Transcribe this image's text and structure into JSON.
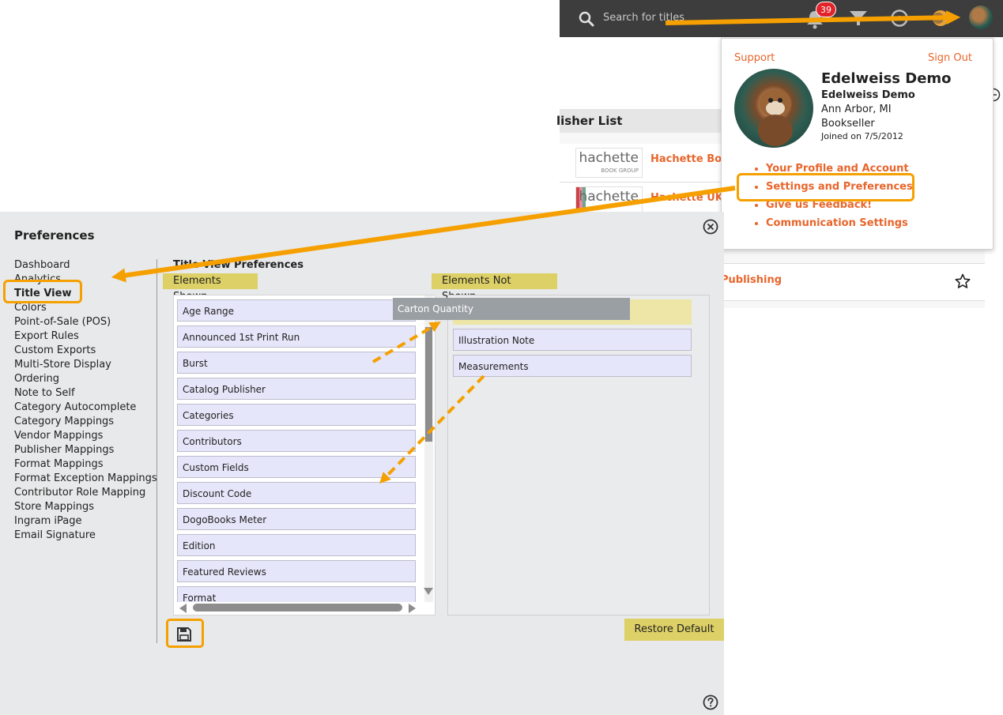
{
  "topbar": {
    "search_placeholder": "Search for titles",
    "notification_count": "39",
    "icons": [
      "search-icon",
      "bell-icon",
      "filter-icon",
      "circle-icon",
      "orange-circle-icon",
      "avatar"
    ]
  },
  "background_page": {
    "header": "lisher List",
    "rows": [
      {
        "logo_text": "hachette",
        "logo_sub": "BOOK GROUP",
        "link": "Hachette Book"
      },
      {
        "logo_text": "hachette",
        "logo_sub": "",
        "link": "Hachette UK G"
      }
    ],
    "publishing_link": "Publishing"
  },
  "profile": {
    "support_label": "Support",
    "signout_label": "Sign Out",
    "name": "Edelweiss Demo",
    "organization": "Edelweiss Demo",
    "location": "Ann Arbor, MI",
    "role": "Bookseller",
    "joined": "Joined on 7/5/2012",
    "menu": [
      "Your Profile and Account",
      "Settings and Preferences",
      "Give us Feedback!",
      "Communication Settings"
    ]
  },
  "preferences": {
    "title": "Preferences",
    "nav": [
      "Dashboard",
      "Analytics",
      "Title View",
      "Colors",
      "Point-of-Sale (POS)",
      "Export Rules",
      "Custom Exports",
      "Multi-Store Display",
      "Ordering",
      "Note to Self",
      "Category Autocomplete",
      "Category Mappings",
      "Vendor Mappings",
      "Publisher Mappings",
      "Format Mappings",
      "Format Exception Mappings",
      "Contributor Role Mapping",
      "Store Mappings",
      "Ingram iPage",
      "Email Signature"
    ],
    "active_nav": "Title View",
    "section_title": "Title View Preferences",
    "elements_shown_label": "Elements Shown",
    "elements_not_shown_label": "Elements Not Shown",
    "elements_shown": [
      "Age Range",
      "Announced 1st Print Run",
      "Burst",
      "Catalog Publisher",
      "Categories",
      "Contributors",
      "Custom Fields",
      "Discount Code",
      "DogoBooks Meter",
      "Edition",
      "Featured Reviews",
      "Format"
    ],
    "elements_not_shown": [
      "Illustration Note",
      "Measurements"
    ],
    "dragging_item": "Carton Quantity",
    "restore_default_label": "Restore Default"
  },
  "colors": {
    "accent_orange": "#f5a000",
    "link_orange": "#e8652b",
    "label_yellow": "#ddd066",
    "item_lavender": "#e6e6fa",
    "badge_red": "#e2232a"
  }
}
